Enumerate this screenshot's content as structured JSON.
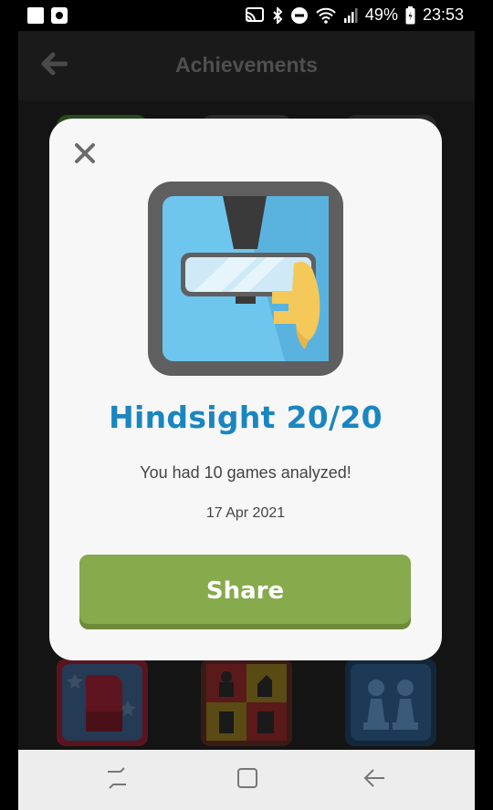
{
  "status_bar": {
    "battery": "49%",
    "time": "23:53"
  },
  "app_bar": {
    "title": "Achievements",
    "back_icon": "arrow-left-icon"
  },
  "dialog": {
    "close_icon": "close-icon",
    "badge_icon": "rearview-mirror-icon",
    "title": "Hindsight 20/20",
    "description": "You had 10 games analyzed!",
    "date": "17 Apr 2021",
    "share_label": "Share"
  },
  "colors": {
    "accent_title": "#1a86c0",
    "share_button": "#86aa4c",
    "badge_sky": "#6ec6ef"
  }
}
